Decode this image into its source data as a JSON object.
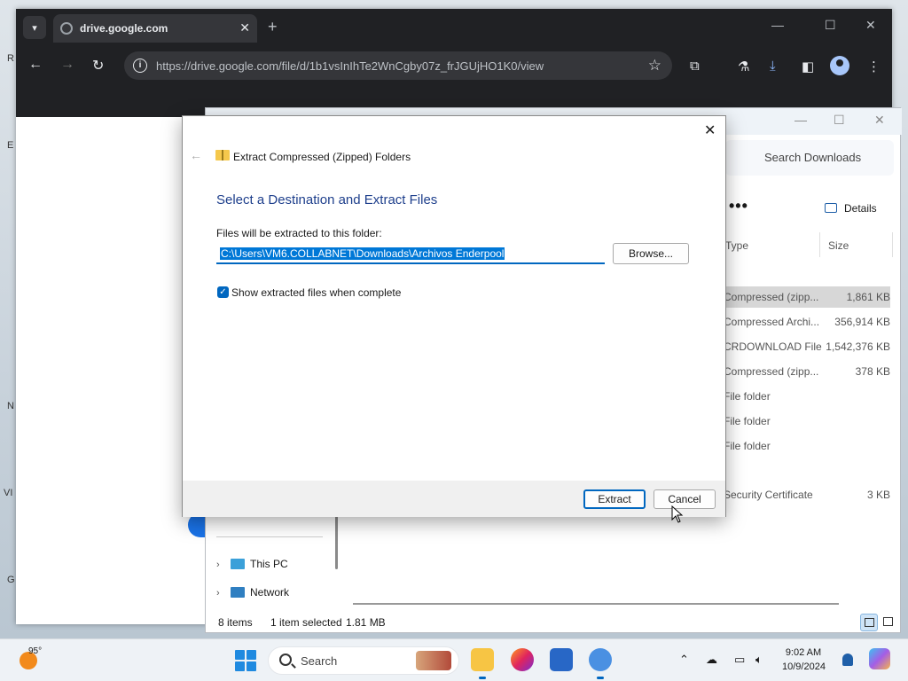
{
  "desktop": {
    "side_letters": [
      "R",
      "E",
      "N",
      "VI",
      "G"
    ]
  },
  "browser": {
    "tab_title": "drive.google.com",
    "url": "https://drive.google.com/file/d/1b1vsInIhTe2WnCgby07z_frJGUjHO1K0/view",
    "new_tab_glyph": "+",
    "close_glyph": "✕"
  },
  "explorer": {
    "search_placeholder": "Search Downloads",
    "more_glyph": "•••",
    "details_label": "Details",
    "columns": {
      "type": "Type",
      "size": "Size"
    },
    "rows": [
      {
        "type": "Compressed (zipp...",
        "size": "1,861 KB",
        "selected": true
      },
      {
        "type": "Compressed Archi...",
        "size": "356,914 KB"
      },
      {
        "type": "CRDOWNLOAD File",
        "size": "1,542,376 KB"
      },
      {
        "type": "Compressed (zipp...",
        "size": "378 KB"
      },
      {
        "type": "File folder",
        "size": ""
      },
      {
        "type": "File folder",
        "size": ""
      },
      {
        "type": "File folder",
        "size": ""
      },
      {
        "type": "",
        "size": ""
      },
      {
        "type": "Security Certificate",
        "size": "3 KB"
      }
    ],
    "nav": {
      "this_pc": "This PC",
      "network": "Network"
    },
    "status": {
      "items": "8 items",
      "selected": "1 item selected",
      "size": "1.81 MB"
    }
  },
  "dialog": {
    "title": "Extract Compressed (Zipped) Folders",
    "heading": "Select a Destination and Extract Files",
    "path_label": "Files will be extracted to this folder:",
    "path_value": "C:\\Users\\VM6.COLLABNET\\Downloads\\Archivos Enderpool",
    "browse_label": "Browse...",
    "show_files_label": "Show extracted files when complete",
    "show_files_checked": true,
    "extract_label": "Extract",
    "cancel_label": "Cancel"
  },
  "taskbar": {
    "temperature": "95°",
    "search_label": "Search",
    "time": "9:02 AM",
    "date": "10/9/2024"
  },
  "colors": {
    "accent": "#0067c0",
    "dialog_heading": "#1e3f8c",
    "chrome_frame": "#202124"
  }
}
